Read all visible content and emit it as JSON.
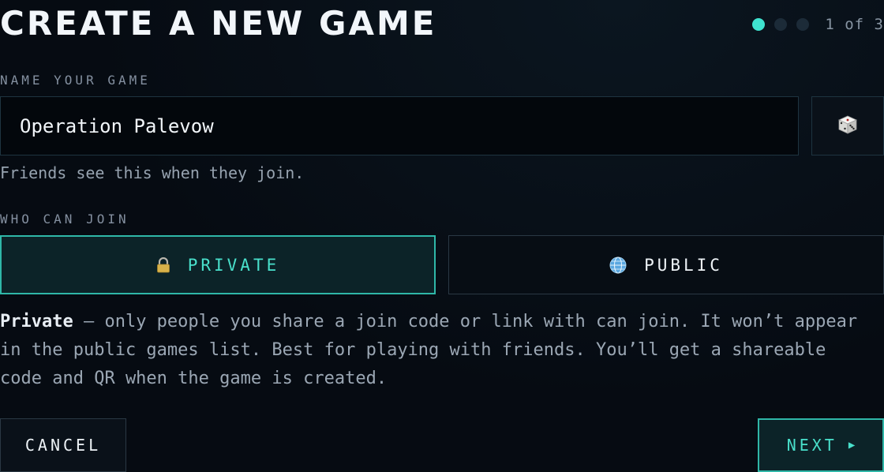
{
  "header": {
    "title": "CREATE A NEW GAME",
    "step_text": "1 of 3",
    "steps_total": 3,
    "current_step": 1
  },
  "name_section": {
    "label": "NAME YOUR GAME",
    "value": "Operation Palevow",
    "helper": "Friends see this when they join.",
    "randomize_icon": "dice-icon"
  },
  "join_section": {
    "label": "WHO CAN JOIN",
    "options": [
      {
        "label": "PRIVATE",
        "icon": "lock-icon",
        "selected": true
      },
      {
        "label": "PUBLIC",
        "icon": "globe-icon",
        "selected": false
      }
    ],
    "description_bold": "Private",
    "description_rest": " — only people you share a join code or link with can join. It won’t appear in the public games list. Best for playing with friends. You’ll get a shareable code and QR when the game is created."
  },
  "footer": {
    "cancel_label": "CANCEL",
    "next_label": "NEXT",
    "next_arrow": "▶"
  },
  "colors": {
    "accent": "#3fe3cf",
    "background": "#060b12",
    "selected_bg": "#0c2328"
  }
}
